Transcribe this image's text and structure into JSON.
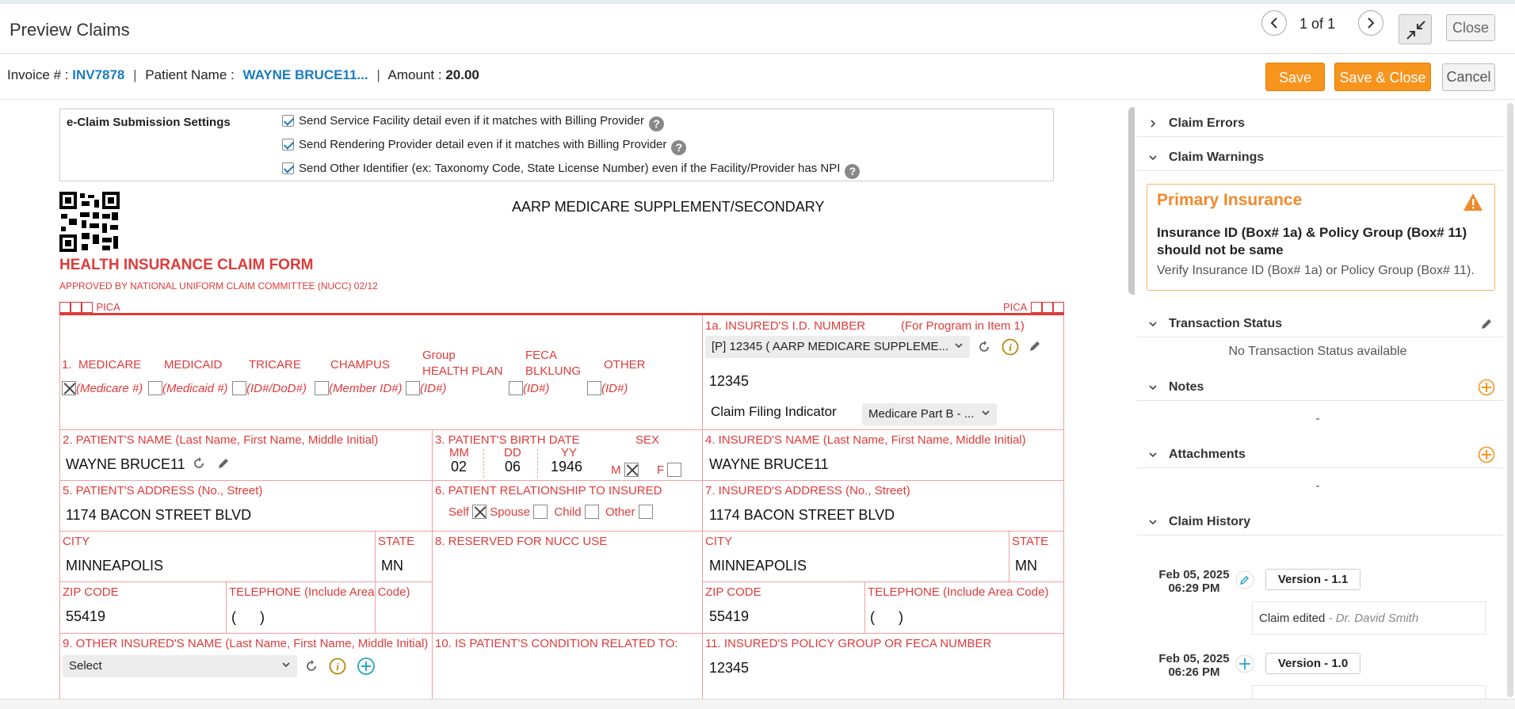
{
  "header": {
    "title": "Preview Claims",
    "page_current": "1",
    "page_of": "of",
    "page_total": "1",
    "close_label": "Close"
  },
  "info": {
    "invoice_label": "Invoice # :",
    "invoice_value": "INV7878",
    "patient_label": "Patient Name :",
    "patient_value": "WAYNE BRUCE11...",
    "amount_label": "Amount :",
    "amount_value": "20.00",
    "save": "Save",
    "save_close": "Save & Close",
    "cancel": "Cancel"
  },
  "ecs": {
    "label": "e-Claim Submission Settings",
    "items": [
      "Send Service Facility detail even if it matches with Billing Provider",
      "Send Rendering Provider detail even if it matches with Billing Provider",
      "Send Other Identifier (ex: Taxonomy Code, State License Number) even if the Facility/Provider has NPI"
    ]
  },
  "form": {
    "payer": "AARP MEDICARE SUPPLEMENT/SECONDARY",
    "title": "HEALTH INSURANCE CLAIM FORM",
    "approved": "APPROVED BY NATIONAL UNIFORM CLAIM COMMITTEE (NUCC) 02/12",
    "pica": "PICA",
    "b1_num": "1.",
    "medicare": "MEDICARE",
    "medicaid": "MEDICAID",
    "tricare": "TRICARE",
    "champus": "CHAMPUS",
    "group1": "Group",
    "group2": "HEALTH PLAN",
    "feca1": "FECA",
    "feca2": "BLKLUNG",
    "other": "OTHER",
    "medicare_id": "(Medicare #)",
    "medicaid_id": "(Medicaid #)",
    "tricare_id": "(ID#/DoD#)",
    "champus_id": "(Member ID#)",
    "group_id": "(ID#)",
    "feca_id": "(ID#)",
    "other_id": "(ID#)",
    "b1a_label": "1a. INSURED'S I.D. NUMBER",
    "b1a_prog": "(For Program in Item 1)",
    "b1a_select": "[P] 12345 ( AARP MEDICARE SUPPLEME...",
    "b1a_value": "12345",
    "cfi_label": "Claim Filing Indicator",
    "cfi_value": "Medicare Part B - ...",
    "b2_label": "2. PATIENT'S NAME (Last Name, First Name, Middle Initial)",
    "b2_value": "WAYNE BRUCE11",
    "b3_label": "3. PATIENT'S BIRTH DATE",
    "sex_label": "SEX",
    "mm": "MM",
    "dd": "DD",
    "yy": "YY",
    "mm_v": "02",
    "dd_v": "06",
    "yy_v": "1946",
    "m": "M",
    "f": "F",
    "b4_label": "4. INSURED'S NAME (Last Name, First Name, Middle Initial)",
    "b4_value": "WAYNE BRUCE11",
    "b5_label": "5. PATIENT'S ADDRESS (No., Street)",
    "b5_value": "1174 BACON STREET BLVD",
    "b6_label": "6. PATIENT RELATIONSHIP TO INSURED",
    "self": "Self",
    "spouse": "Spouse",
    "child": "Child",
    "other_rel": "Other",
    "b7_label": "7. INSURED'S ADDRESS (No., Street)",
    "b7_value": "1174 BACON STREET BLVD",
    "city": "CITY",
    "state": "STATE",
    "city_v": "MINNEAPOLIS",
    "state_v": "MN",
    "ins_city_v": "MINNEAPOLIS",
    "ins_state_v": "MN",
    "b8_label": "8. RESERVED FOR NUCC USE",
    "zip": "ZIP CODE",
    "tel": "TELEPHONE (Include Area Code)",
    "zip_v": "55419",
    "tel_v": "(      )",
    "ins_zip_v": "55419",
    "ins_tel_v": "(      )",
    "b9_label": "9. OTHER INSURED'S NAME (Last Name, First Name, Middle Initial)",
    "b9_select": "Select",
    "b10_label": "10. IS PATIENT'S CONDITION RELATED TO:",
    "b11_label": "11. INSURED'S POLICY GROUP OR FECA NUMBER",
    "b11_value": "12345"
  },
  "panel": {
    "claim_errors": "Claim Errors",
    "claim_warnings": "Claim Warnings",
    "warn_title": "Primary Insurance",
    "warn_msg": "Insurance ID (Box# 1a) & Policy Group (Box# 11) should not be same",
    "warn_sub": "Verify Insurance ID (Box# 1a) or Policy Group (Box# 11).",
    "transaction": "Transaction Status",
    "transaction_empty": "No Transaction Status available",
    "notes": "Notes",
    "notes_empty": "-",
    "attachments": "Attachments",
    "attachments_empty": "-",
    "history": "Claim History",
    "h1_date": "Feb 05, 2025",
    "h1_time": "06:29 PM",
    "h1_ver": "Version - 1.1",
    "h1_msg": "Claim edited",
    "h1_by": " - Dr. David Smith",
    "h2_date": "Feb 05, 2025",
    "h2_time": "06:26 PM",
    "h2_ver": "Version - 1.0"
  },
  "colors": {
    "accent": "#f7941d",
    "form_red": "#e03a3a",
    "link_blue": "#1a7cc1"
  }
}
